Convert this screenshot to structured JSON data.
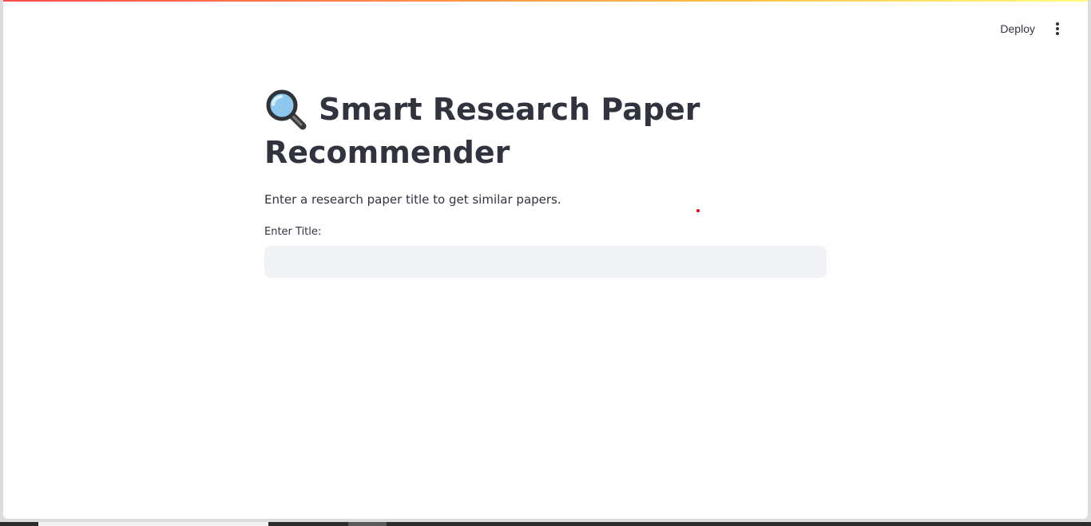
{
  "header": {
    "deploy_label": "Deploy",
    "menu_icon": "kebab-menu-icon"
  },
  "main": {
    "title_icon": "magnifying-glass-icon",
    "title": "Smart Research Paper Recommender",
    "caption": "Enter a research paper title to get similar papers.",
    "input": {
      "label": "Enter Title:",
      "value": "",
      "placeholder": ""
    }
  },
  "colors": {
    "text": "#31333f",
    "input_background": "#f0f2f6",
    "decoration_start": "#ff4b4b",
    "decoration_mid": "#ffbd45",
    "decoration_end": "#fffd80"
  }
}
